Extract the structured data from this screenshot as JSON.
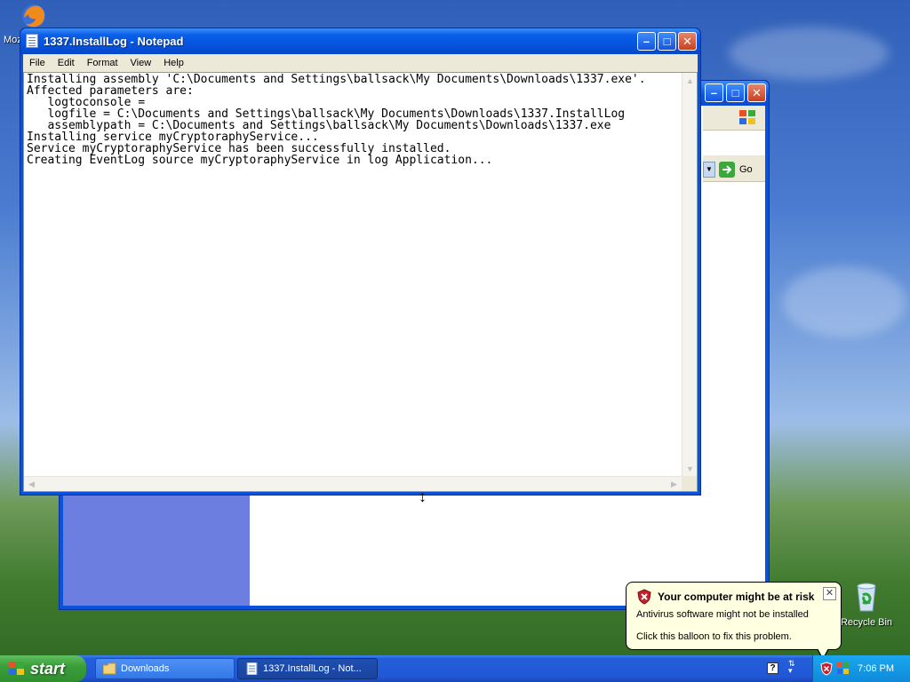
{
  "desktop": {
    "icons": [
      {
        "label": "Moz",
        "name": "firefox"
      },
      {
        "label": "Recycle Bin",
        "name": "recycle-bin"
      }
    ]
  },
  "explorer": {
    "go_label": "Go"
  },
  "notepad": {
    "title": "1337.InstallLog - Notepad",
    "menu": [
      "File",
      "Edit",
      "Format",
      "View",
      "Help"
    ],
    "content": "Installing assembly 'C:\\Documents and Settings\\ballsack\\My Documents\\Downloads\\1337.exe'.\nAffected parameters are:\n   logtoconsole = \n   logfile = C:\\Documents and Settings\\ballsack\\My Documents\\Downloads\\1337.InstallLog\n   assemblypath = C:\\Documents and Settings\\ballsack\\My Documents\\Downloads\\1337.exe\nInstalling service myCryptoraphyService...\nService myCryptoraphyService has been successfully installed.\nCreating EventLog source myCryptoraphyService in log Application..."
  },
  "taskbar": {
    "start_label": "start",
    "tasks": [
      {
        "label": "Downloads",
        "icon": "folder-icon"
      },
      {
        "label": "1337.InstallLog - Not...",
        "icon": "notepad-icon"
      }
    ],
    "clock": "7:06 PM"
  },
  "balloon": {
    "title": "Your computer might be at risk",
    "line1": "Antivirus software might not be installed",
    "line2": "Click this balloon to fix this problem."
  },
  "colors": {
    "title_bar": "#0a53d8",
    "taskbar": "#245edb",
    "start": "#3a9e3a",
    "balloon_bg": "#ffffe1"
  }
}
